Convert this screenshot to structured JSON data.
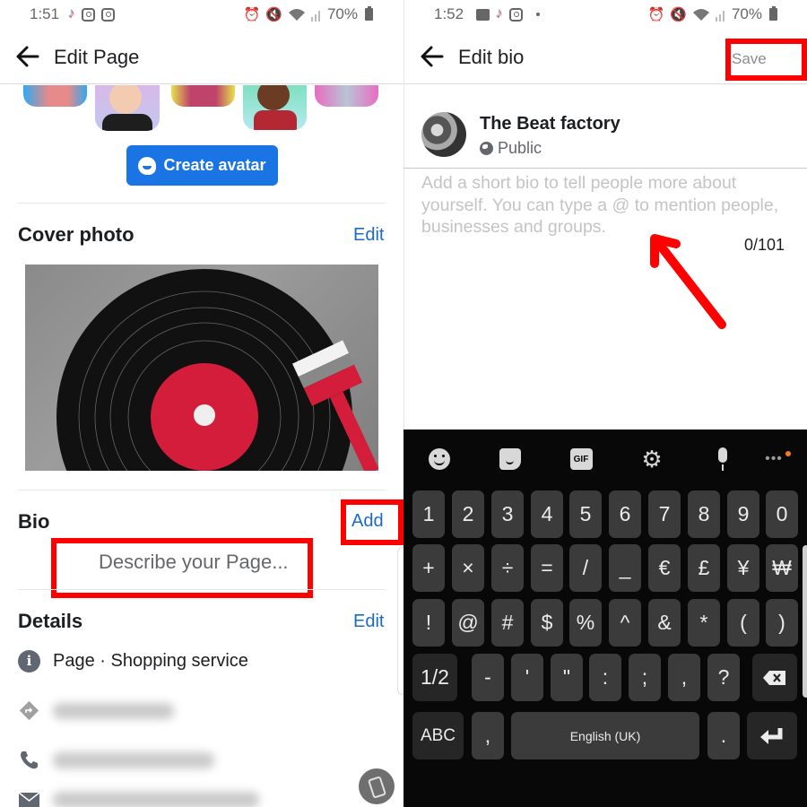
{
  "left_screen": {
    "status_bar": {
      "time": "1:51",
      "notification_icons": [
        "tiktok-icon",
        "instagram-icon",
        "instagram-icon"
      ],
      "system_icons": [
        "alarm-icon",
        "mute-icon",
        "wifi-icon",
        "signal-icon"
      ],
      "battery": "70%"
    },
    "header": {
      "back_icon": "arrow-left-icon",
      "title": "Edit Page"
    },
    "avatar_section": {
      "avatar_count": 5,
      "create_avatar_button": "Create avatar"
    },
    "cover_photo": {
      "title": "Cover photo",
      "edit_label": "Edit",
      "image_description": "Vinyl record being painted with red brush"
    },
    "bio": {
      "title": "Bio",
      "add_label": "Add",
      "placeholder": "Describe your Page..."
    },
    "details": {
      "title": "Details",
      "edit_label": "Edit",
      "rows": [
        {
          "icon": "info-icon",
          "text": "Page · Shopping service"
        },
        {
          "icon": "directions-icon",
          "text": "",
          "blurred": true
        },
        {
          "icon": "phone-icon",
          "text": "",
          "blurred": true
        },
        {
          "icon": "email-icon",
          "text": "",
          "blurred": true
        }
      ]
    }
  },
  "right_screen": {
    "status_bar": {
      "time": "1:52",
      "notification_icons": [
        "gallery-icon",
        "tiktok-icon",
        "instagram-icon",
        "dot-icon"
      ],
      "system_icons": [
        "alarm-icon",
        "mute-icon",
        "wifi-icon",
        "signal-icon"
      ],
      "battery": "70%"
    },
    "header": {
      "back_icon": "arrow-left-icon",
      "title": "Edit bio",
      "save_label": "Save"
    },
    "profile": {
      "name": "The Beat factory",
      "privacy": "Public"
    },
    "bio_input": {
      "value": "",
      "placeholder": "Add a short bio to tell people more about yourself. You can type a @ to mention people, businesses and groups."
    },
    "char_counter": "0/101",
    "keyboard": {
      "toolbar": [
        "emoji-icon",
        "sticker-icon",
        "gif-icon",
        "settings-icon",
        "mic-icon",
        "more-icon"
      ],
      "gif_label": "GIF",
      "more_label": "•••",
      "row1": [
        "1",
        "2",
        "3",
        "4",
        "5",
        "6",
        "7",
        "8",
        "9",
        "0"
      ],
      "row2": [
        "+",
        "×",
        "÷",
        "=",
        "/",
        "_",
        "€",
        "£",
        "¥",
        "₩"
      ],
      "row3": [
        "!",
        "@",
        "#",
        "$",
        "%",
        "^",
        "&",
        "*",
        "(",
        ")"
      ],
      "row4": [
        "1/2",
        "-",
        "'",
        "\"",
        ":",
        ";",
        ",",
        "?"
      ],
      "row5": {
        "abc": "ABC",
        "comma": ",",
        "space": "English (UK)",
        "period": "."
      }
    }
  },
  "annotations": {
    "highlight_color": "#ff0000"
  },
  "colors": {
    "link_blue": "#1b6ac9",
    "button_blue": "#1b74e4",
    "keyboard_bg": "#080808",
    "key_bg": "#3b3b3b"
  }
}
